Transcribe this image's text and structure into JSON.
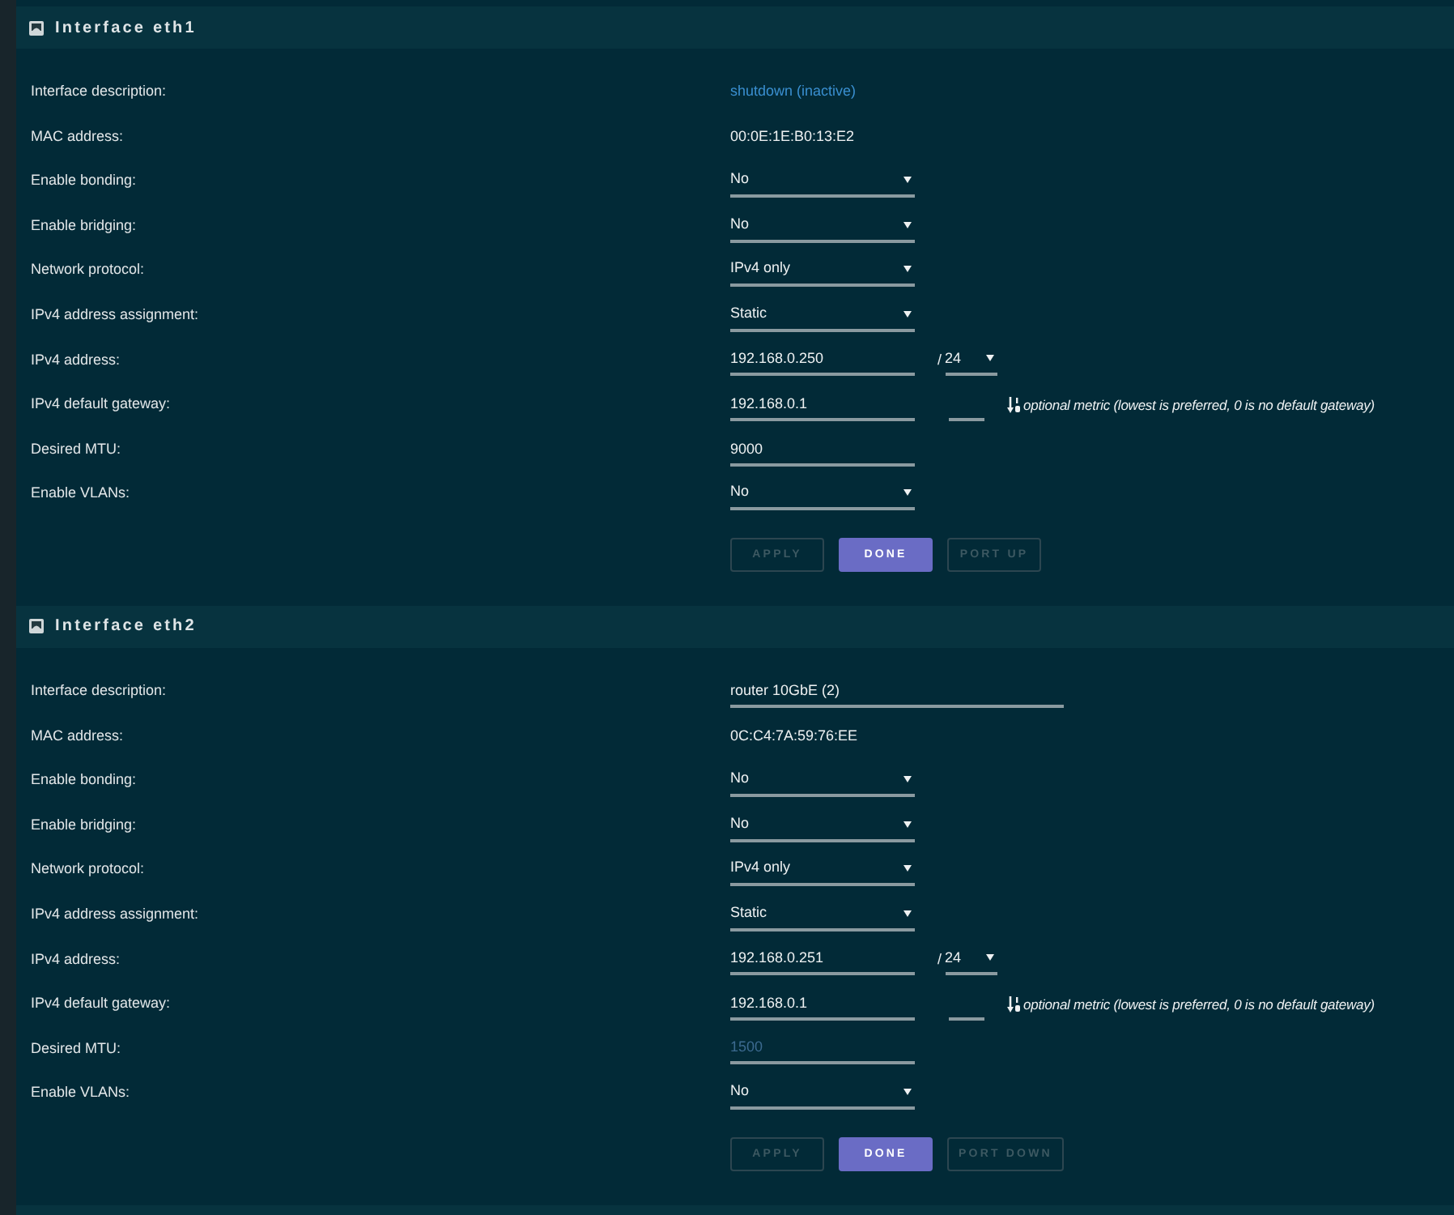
{
  "interfaces": [
    {
      "title": "Interface eth1",
      "fields": [
        {
          "label": "Interface description:",
          "kind": "link",
          "value": "shutdown (inactive)"
        },
        {
          "label": "MAC address:",
          "kind": "text",
          "value": "00:0E:1E:B0:13:E2"
        },
        {
          "label": "Enable bonding:",
          "kind": "select",
          "value": "No"
        },
        {
          "label": "Enable bridging:",
          "kind": "select",
          "value": "No"
        },
        {
          "label": "Network protocol:",
          "kind": "select",
          "value": "IPv4 only"
        },
        {
          "label": "IPv4 address assignment:",
          "kind": "select",
          "value": "Static"
        },
        {
          "label": "IPv4 address:",
          "kind": "address",
          "value": "192.168.0.250",
          "separator": "/",
          "prefix": "24"
        },
        {
          "label": "IPv4 default gateway:",
          "kind": "gateway",
          "value": "192.168.0.1",
          "hint": "optional metric (lowest is preferred, 0 is no default gateway)"
        },
        {
          "label": "Desired MTU:",
          "kind": "input",
          "value": "9000"
        },
        {
          "label": "Enable VLANs:",
          "kind": "select",
          "value": "No"
        }
      ],
      "buttons": [
        {
          "label": "APPLY",
          "kind": "secondary",
          "disabled": true
        },
        {
          "label": "DONE",
          "kind": "primary",
          "disabled": false
        },
        {
          "label": "PORT UP",
          "kind": "secondary",
          "disabled": true
        }
      ]
    },
    {
      "title": "Interface eth2",
      "fields": [
        {
          "label": "Interface description:",
          "kind": "longinput",
          "value": "router 10GbE (2)"
        },
        {
          "label": "MAC address:",
          "kind": "text",
          "value": "0C:C4:7A:59:76:EE"
        },
        {
          "label": "Enable bonding:",
          "kind": "select",
          "value": "No"
        },
        {
          "label": "Enable bridging:",
          "kind": "select",
          "value": "No"
        },
        {
          "label": "Network protocol:",
          "kind": "select",
          "value": "IPv4 only"
        },
        {
          "label": "IPv4 address assignment:",
          "kind": "select",
          "value": "Static"
        },
        {
          "label": "IPv4 address:",
          "kind": "address",
          "value": "192.168.0.251",
          "separator": "/",
          "prefix": "24"
        },
        {
          "label": "IPv4 default gateway:",
          "kind": "gateway",
          "value": "192.168.0.1",
          "hint": "optional metric (lowest is preferred, 0 is no default gateway)"
        },
        {
          "label": "Desired MTU:",
          "kind": "input",
          "placeholder": "1500"
        },
        {
          "label": "Enable VLANs:",
          "kind": "select",
          "value": "No"
        }
      ],
      "buttons": [
        {
          "label": "APPLY",
          "kind": "secondary",
          "disabled": true
        },
        {
          "label": "DONE",
          "kind": "primary",
          "disabled": false
        },
        {
          "label": "PORT DOWN",
          "kind": "secondary",
          "disabled": true
        }
      ]
    }
  ]
}
